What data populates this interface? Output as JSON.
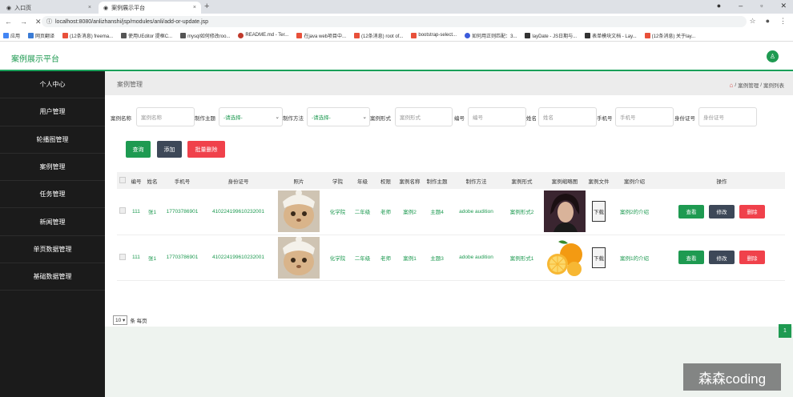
{
  "browser": {
    "tabs": [
      {
        "label": "入口页"
      },
      {
        "label": "案例展示平台"
      }
    ],
    "url": "localhost:8080/anlizhanshi/jsp/modules/anli/add-or-update.jsp",
    "bookmarks": [
      "应用",
      "网页翻译",
      "(12条消息) freema...",
      "使用UEditor 提框C...",
      "mysql如何修改roo...",
      "README.md - Ter...",
      "在java web项目中...",
      "(12条消息) root of...",
      "bootstrap-select...",
      "如何用正则匹配：3...",
      "layDate - JS日期与...",
      "表单模块文档 - Lay...",
      "(12条消息) 关于lay..."
    ]
  },
  "header": {
    "brand": "案例展示平台"
  },
  "sidebar": {
    "items": [
      {
        "label": "个人中心"
      },
      {
        "label": "用户管理"
      },
      {
        "label": "轮播图管理"
      },
      {
        "label": "案例管理"
      },
      {
        "label": "任务管理"
      },
      {
        "label": "新闻管理"
      },
      {
        "label": "单页数据管理"
      },
      {
        "label": "基础数据管理"
      }
    ]
  },
  "breadcrumb": {
    "title": "案例管理",
    "path": [
      "案例管理",
      "案例列表"
    ],
    "sep": "/"
  },
  "search": {
    "f1_label": "案例名称",
    "f1_placeholder": "案例名称",
    "f2_label": "制作主题",
    "f2_value": "-请选择-",
    "f3_label": "制作方法",
    "f3_value": "-请选择-",
    "f4_label": "案例形式",
    "f4_placeholder": "案例形式",
    "f5_label": "编号",
    "f5_placeholder": "编号",
    "f6_label": "姓名",
    "f6_placeholder": "姓名",
    "f7_label": "手机号",
    "f7_placeholder": "手机号",
    "f8_label": "身份证号",
    "f8_placeholder": "身份证号"
  },
  "buttons": {
    "query": "查询",
    "add": "添加",
    "batch_delete": "批量删除"
  },
  "table": {
    "headers": [
      "",
      "编号",
      "姓名",
      "手机号",
      "身份证号",
      "照片",
      "学院",
      "年级",
      "权限",
      "案例名称",
      "制作主题",
      "制作方法",
      "案例形式",
      "案例缩略图",
      "案例文件",
      "案例介绍",
      "操作"
    ],
    "rows": [
      {
        "id": "111",
        "name": "张1",
        "phone": "17703786901",
        "idcard": "410224199610232001",
        "college": "化学院",
        "grade": "二年级",
        "role": "老师",
        "case_name": "案例2",
        "theme": "主题4",
        "method": "adobe audition",
        "form": "案例形式2",
        "download": "下载",
        "intro": "案例2的介绍",
        "view": "查看",
        "edit": "修改",
        "del": "删除"
      },
      {
        "id": "111",
        "name": "张1",
        "phone": "17703786901",
        "idcard": "410224199610232001",
        "college": "化学院",
        "grade": "二年级",
        "role": "老师",
        "case_name": "案例1",
        "theme": "主题3",
        "method": "adobe audition",
        "form": "案例形式1",
        "download": "下载",
        "intro": "案例1的介绍",
        "view": "查看",
        "edit": "修改",
        "del": "删除"
      }
    ]
  },
  "pager": {
    "page_size": "10",
    "suffix": "条 每页",
    "current": "1"
  },
  "watermark": "森森coding"
}
